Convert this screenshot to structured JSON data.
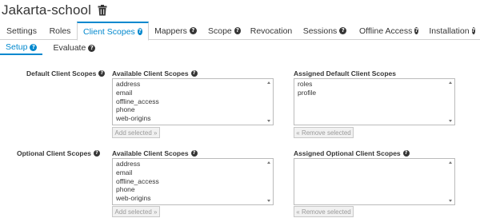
{
  "header": {
    "title": "Jakarta-school",
    "delete_icon": "trash-icon"
  },
  "tabs": [
    {
      "label": "Settings",
      "help": false,
      "active": false
    },
    {
      "label": "Roles",
      "help": false,
      "active": false
    },
    {
      "label": "Client Scopes",
      "help": true,
      "active": true
    },
    {
      "label": "Mappers",
      "help": true,
      "active": false
    },
    {
      "label": "Scope",
      "help": true,
      "active": false
    },
    {
      "label": "Revocation",
      "help": false,
      "active": false
    },
    {
      "label": "Sessions",
      "help": true,
      "active": false
    },
    {
      "label": "Offline Access",
      "help": true,
      "active": false
    },
    {
      "label": "Installation",
      "help": true,
      "active": false
    }
  ],
  "subtabs": [
    {
      "label": "Setup",
      "help": true,
      "active": true
    },
    {
      "label": "Evaluate",
      "help": true,
      "active": false
    }
  ],
  "help_glyph": "?",
  "default_scopes": {
    "row_label": "Default Client Scopes",
    "available_label": "Available Client Scopes",
    "available_items": [
      "address",
      "email",
      "offline_access",
      "phone",
      "web-origins"
    ],
    "add_button": "Add selected »",
    "assigned_label": "Assigned Default Client Scopes",
    "assigned_items": [
      "roles",
      "profile"
    ],
    "remove_button": "« Remove selected"
  },
  "optional_scopes": {
    "row_label": "Optional Client Scopes",
    "available_label": "Available Client Scopes",
    "available_items": [
      "address",
      "email",
      "offline_access",
      "phone",
      "web-origins"
    ],
    "add_button": "Add selected »",
    "assigned_label": "Assigned Optional Client Scopes",
    "assigned_items": [],
    "remove_button": "« Remove selected"
  },
  "colors": {
    "accent": "#0088ce",
    "text": "#363636",
    "border": "#d1d1d1"
  }
}
